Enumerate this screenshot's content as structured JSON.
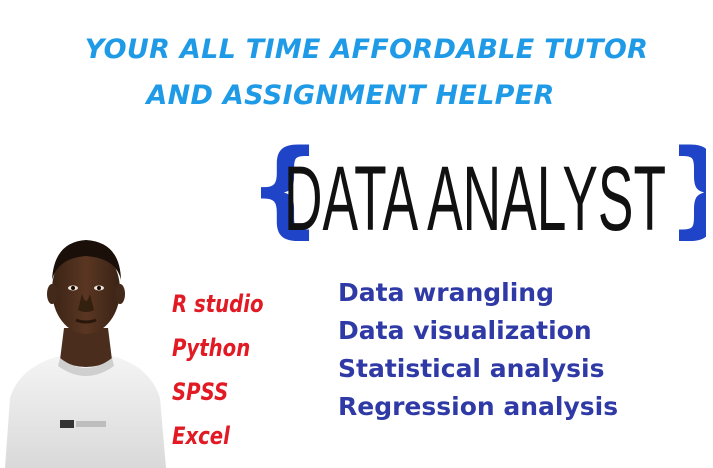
{
  "headline": {
    "line1": "YOUR ALL TIME AFFORDABLE TUTOR",
    "line2": "AND ASSIGNMENT HELPER"
  },
  "logo": {
    "open_brace": "{",
    "text": "DATA ANALYST",
    "close_brace": "}"
  },
  "tools": [
    "R studio",
    "Python",
    "SPSS",
    "Excel"
  ],
  "services": [
    "Data wrangling",
    "Data visualization",
    "Statistical analysis",
    "Regression analysis"
  ],
  "colors": {
    "headline": "#1e9ae6",
    "brace": "#1f44c8",
    "logo_text": "#111111",
    "tools": "#e11a24",
    "services": "#2f3aa6"
  }
}
